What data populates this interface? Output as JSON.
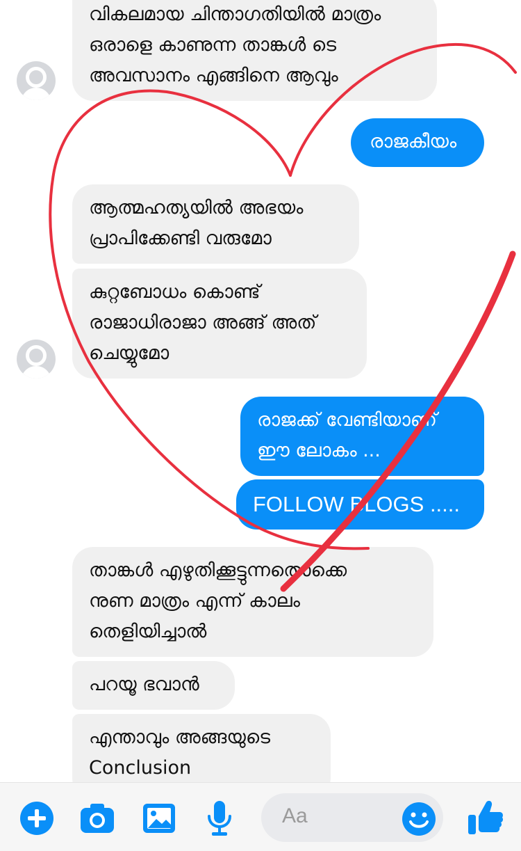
{
  "messages": [
    {
      "id": "m1",
      "dir": "in",
      "text": "വികലമായ ചിന്താഗതിയിൽ മാത്രം\nഒരാളെ കാണുന്ന താങ്കൾ ടെ\nഅവസാനം എങ്ങിനെ ആവും"
    },
    {
      "id": "m2",
      "dir": "out",
      "text": "രാജകീയം"
    },
    {
      "id": "m3",
      "dir": "in",
      "text": "ആത്മഹത്യയിൽ അഭയം\nപ്രാപിക്കേണ്ടി വരുമോ"
    },
    {
      "id": "m4",
      "dir": "in",
      "text": "കുറ്റബോധം കൊണ്ട്\nരാജാധിരാജാ അങ്ങ് അത്\nചെയ്യുമോ"
    },
    {
      "id": "m5",
      "dir": "out",
      "text": "രാജക്ക് വേണ്ടിയാണ്\nഈ ലോകം ..."
    },
    {
      "id": "m6",
      "dir": "out",
      "text": "FOLLOW BLOGS ....."
    },
    {
      "id": "m7",
      "dir": "in",
      "text": "താങ്കൾ എഴുതിക്കൂട്ടുന്നതൊക്കെ\nനുണ മാത്രം എന്ന് കാലം\nതെളിയിച്ചാൽ"
    },
    {
      "id": "m8",
      "dir": "in",
      "text": "പറയൂ ഭവാൻ"
    },
    {
      "id": "m9",
      "dir": "in",
      "text": "എന്താവും അങ്ങയുടെ\nConclusion"
    }
  ],
  "composer": {
    "placeholder": "Aa",
    "icons": [
      "plus-icon",
      "camera-icon",
      "image-icon",
      "microphone-icon",
      "emoji-icon",
      "thumbs-up-icon"
    ],
    "accent": "#0a8ff8"
  },
  "colors": {
    "incoming_bubble": "#f0f0f0",
    "outgoing_bubble": "#0a8ff8",
    "heart_drawing": "#e8303f"
  }
}
